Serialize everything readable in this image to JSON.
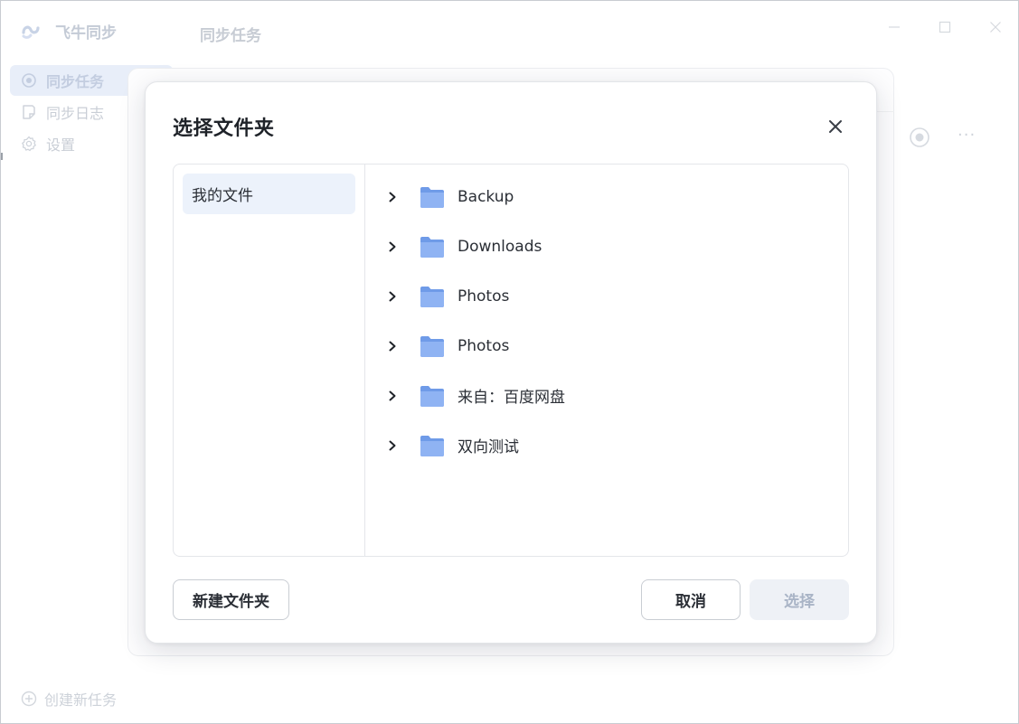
{
  "app": {
    "title": "飞牛同步",
    "page_title": "同步任务",
    "nav": [
      {
        "label": "同步任务",
        "icon": "target-icon",
        "active": true
      },
      {
        "label": "同步日志",
        "icon": "log-icon",
        "active": false
      },
      {
        "label": "设置",
        "icon": "gear-icon",
        "active": false
      }
    ],
    "create_task_label": "创建新任务",
    "more_label": "···",
    "window_controls": {
      "minimize": "—",
      "maximize": "☐",
      "close": "✕"
    }
  },
  "dialog": {
    "title": "选择文件夹",
    "close_icon": "close-icon",
    "roots": [
      {
        "label": "我的文件",
        "selected": true
      }
    ],
    "folders": [
      {
        "name": "Backup"
      },
      {
        "name": "Downloads"
      },
      {
        "name": "Photos"
      },
      {
        "name": "Photos"
      },
      {
        "name": "来自：百度网盘"
      },
      {
        "name": "双向测试"
      }
    ],
    "buttons": {
      "new_folder": "新建文件夹",
      "cancel": "取消",
      "select": "选择"
    }
  },
  "colors": {
    "folder_blue": "#7ea6f0",
    "selected_bg": "#ecf2fb",
    "disabled_btn_bg": "#eef1f6",
    "disabled_btn_text": "#a9b4c6"
  }
}
